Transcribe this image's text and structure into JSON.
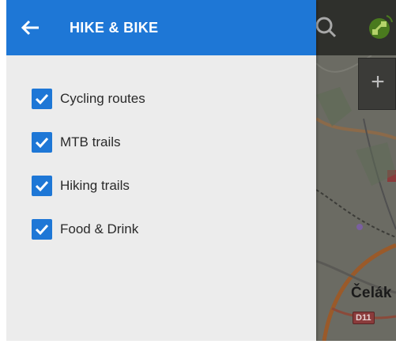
{
  "header": {
    "title": "HIKE & BIKE"
  },
  "filters": [
    {
      "label": "Cycling routes",
      "checked": true
    },
    {
      "label": "MTB trails",
      "checked": true
    },
    {
      "label": "Hiking trails",
      "checked": true
    },
    {
      "label": "Food & Drink",
      "checked": true
    }
  ],
  "map": {
    "place_label": "Čelák",
    "road_badge": "D11"
  },
  "toolbar": {
    "zoom_in_label": "+"
  },
  "colors": {
    "accent": "#1e77d6",
    "drawer_bg": "#ececec"
  }
}
